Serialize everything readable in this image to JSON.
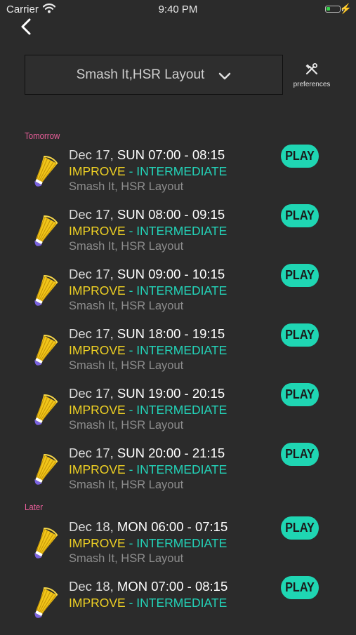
{
  "status_bar": {
    "carrier": "Carrier",
    "time": "9:40 PM"
  },
  "header": {
    "selector_label": "Smash It,HSR Layout",
    "preferences_label": "preferences"
  },
  "sections": [
    {
      "title": "Tomorrow",
      "sessions": [
        {
          "date": "Dec 17,",
          "time": " SUN 07:00 - 08:15",
          "level": "IMPROVE",
          "category": " - INTERMEDIATE",
          "venue": "Smash It, HSR Layout",
          "action": "PLAY"
        },
        {
          "date": "Dec 17,",
          "time": " SUN 08:00 - 09:15",
          "level": "IMPROVE",
          "category": " - INTERMEDIATE",
          "venue": "Smash It, HSR Layout",
          "action": "PLAY"
        },
        {
          "date": "Dec 17,",
          "time": " SUN 09:00 - 10:15",
          "level": "IMPROVE",
          "category": " - INTERMEDIATE",
          "venue": "Smash It, HSR Layout",
          "action": "PLAY"
        },
        {
          "date": "Dec 17,",
          "time": " SUN 18:00 - 19:15",
          "level": "IMPROVE",
          "category": " - INTERMEDIATE",
          "venue": "Smash It, HSR Layout",
          "action": "PLAY"
        },
        {
          "date": "Dec 17,",
          "time": " SUN 19:00 - 20:15",
          "level": "IMPROVE",
          "category": " - INTERMEDIATE",
          "venue": "Smash It, HSR Layout",
          "action": "PLAY"
        },
        {
          "date": "Dec 17,",
          "time": " SUN 20:00 - 21:15",
          "level": "IMPROVE",
          "category": " - INTERMEDIATE",
          "venue": "Smash It, HSR Layout",
          "action": "PLAY"
        }
      ]
    },
    {
      "title": "Later",
      "sessions": [
        {
          "date": "Dec 18,",
          "time": " MON 06:00 - 07:15",
          "level": "IMPROVE",
          "category": " - INTERMEDIATE",
          "venue": "Smash It, HSR Layout",
          "action": "PLAY"
        },
        {
          "date": "Dec 18,",
          "time": " MON 07:00 - 08:15",
          "level": "IMPROVE",
          "category": " - INTERMEDIATE",
          "action": "PLAY"
        }
      ]
    }
  ],
  "icons": {
    "back": "chevron-left-icon",
    "dropdown": "chevron-down-icon",
    "preferences": "tools-icon",
    "session": "shuttlecock-icon",
    "wifi": "wifi-icon",
    "battery": "battery-icon",
    "charging": "charging-bolt-icon"
  },
  "colors": {
    "background": "#2b2b2b",
    "section_title": "#e95e9a",
    "level": "#f0d224",
    "category": "#23d3b8",
    "play_button": "#1fd6b3",
    "venue": "#8d8d8d"
  }
}
